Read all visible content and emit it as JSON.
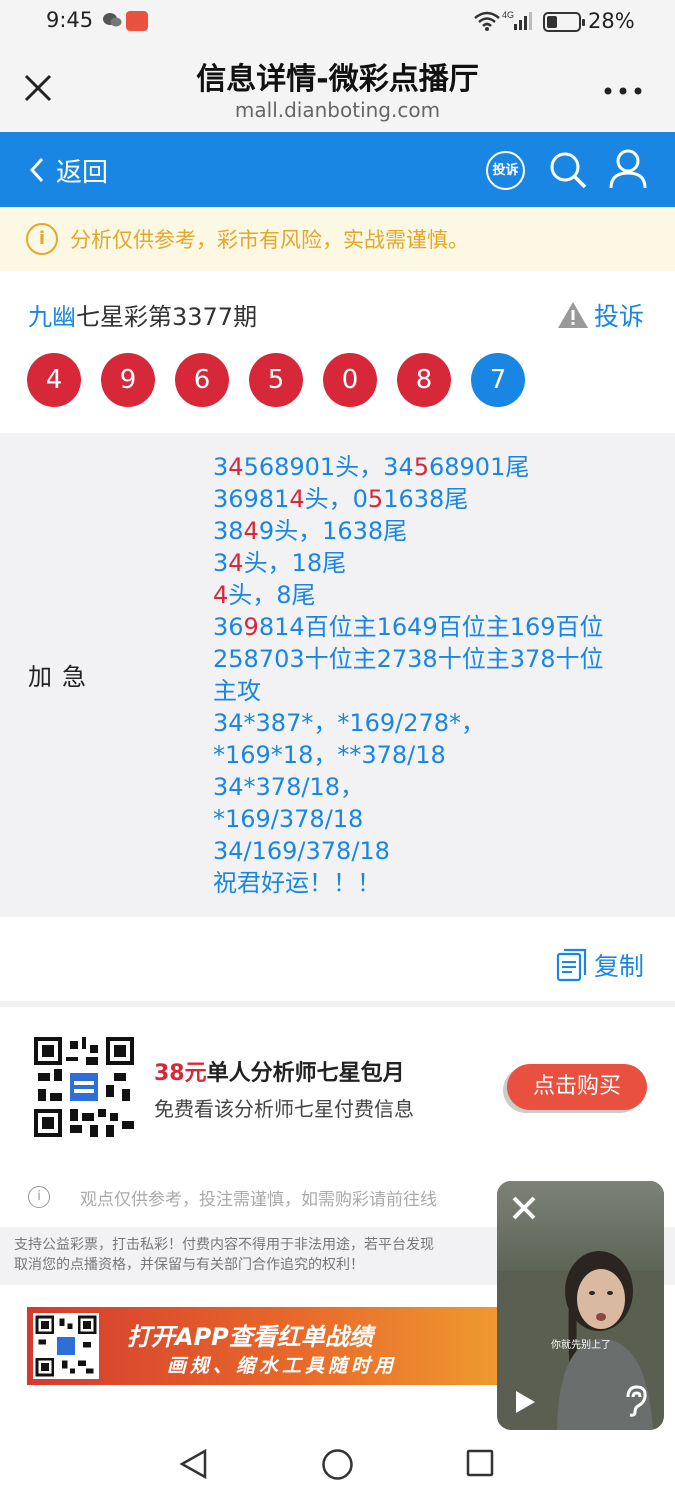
{
  "status_bar": {
    "time": "9:45",
    "battery": "28%",
    "network": "4G"
  },
  "title_bar": {
    "title": "信息详情-微彩点播厅",
    "url": "mall.dianboting.com"
  },
  "nav": {
    "back_label": "返回",
    "complain_badge": "投诉",
    "accent_color": "#1a86e4"
  },
  "warning": {
    "text": "分析仅供参考，彩市有风险，实战需谨慎。",
    "color": "#e4a72a"
  },
  "draw": {
    "name_highlight": "九幽",
    "name_rest": "七星彩第3377期",
    "complain_label": "投诉",
    "balls": [
      {
        "value": "4",
        "color": "red"
      },
      {
        "value": "9",
        "color": "red"
      },
      {
        "value": "6",
        "color": "red"
      },
      {
        "value": "5",
        "color": "red"
      },
      {
        "value": "0",
        "color": "red"
      },
      {
        "value": "8",
        "color": "red"
      },
      {
        "value": "7",
        "color": "blue"
      }
    ]
  },
  "content": {
    "label": "加急",
    "lines": [
      [
        {
          "t": "3"
        },
        {
          "t": "4",
          "hit": true
        },
        {
          "t": "568901头，34"
        },
        {
          "t": "5",
          "hit": true
        },
        {
          "t": "68901尾"
        }
      ],
      [
        {
          "t": "36981"
        },
        {
          "t": "4",
          "hit": true
        },
        {
          "t": "头，0"
        },
        {
          "t": "5",
          "hit": true
        },
        {
          "t": "1638尾"
        }
      ],
      [
        {
          "t": "38"
        },
        {
          "t": "4",
          "hit": true
        },
        {
          "t": "9头，1638尾"
        }
      ],
      [
        {
          "t": "3"
        },
        {
          "t": "4",
          "hit": true
        },
        {
          "t": "头，18尾"
        }
      ],
      [
        {
          "t": "4",
          "hit": true
        },
        {
          "t": "头，8尾"
        }
      ],
      [
        {
          "t": "36"
        },
        {
          "t": "9",
          "hit": true
        },
        {
          "t": "814百位主1649百位主169百位"
        }
      ],
      [
        {
          "t": "258703十位主2738十位主378十位"
        }
      ],
      [
        {
          "t": "主攻"
        }
      ],
      [
        {
          "t": "34*387*，*169/278*，"
        }
      ],
      [
        {
          "t": "*169*18，**378/18"
        }
      ],
      [
        {
          "t": "34*378/18，"
        }
      ],
      [
        {
          "t": "*169/378/18"
        }
      ],
      [
        {
          "t": "34/169/378/18"
        }
      ],
      [
        {
          "t": "祝君好运！！！"
        }
      ]
    ]
  },
  "copy_label": "复制",
  "promo": {
    "price": "38元",
    "title": "单人分析师七星包月",
    "subtitle": "免费看该分析师七星付费信息",
    "buy_label": "点击购买"
  },
  "disclaimer": "观点仅供参考，投注需谨慎，如需购彩请前往线",
  "notice": {
    "line1": "支持公益彩票，打击私彩！付费内容不得用于非法用途，若平台发现",
    "line2": "取消您的点播资格，并保留与有关部门合作追究的权利！"
  },
  "app_banner": {
    "line1": "打开APP查看红单战绩",
    "line2": "画规、缩水工具随时用"
  },
  "video": {
    "caption": "你就先别上了"
  }
}
